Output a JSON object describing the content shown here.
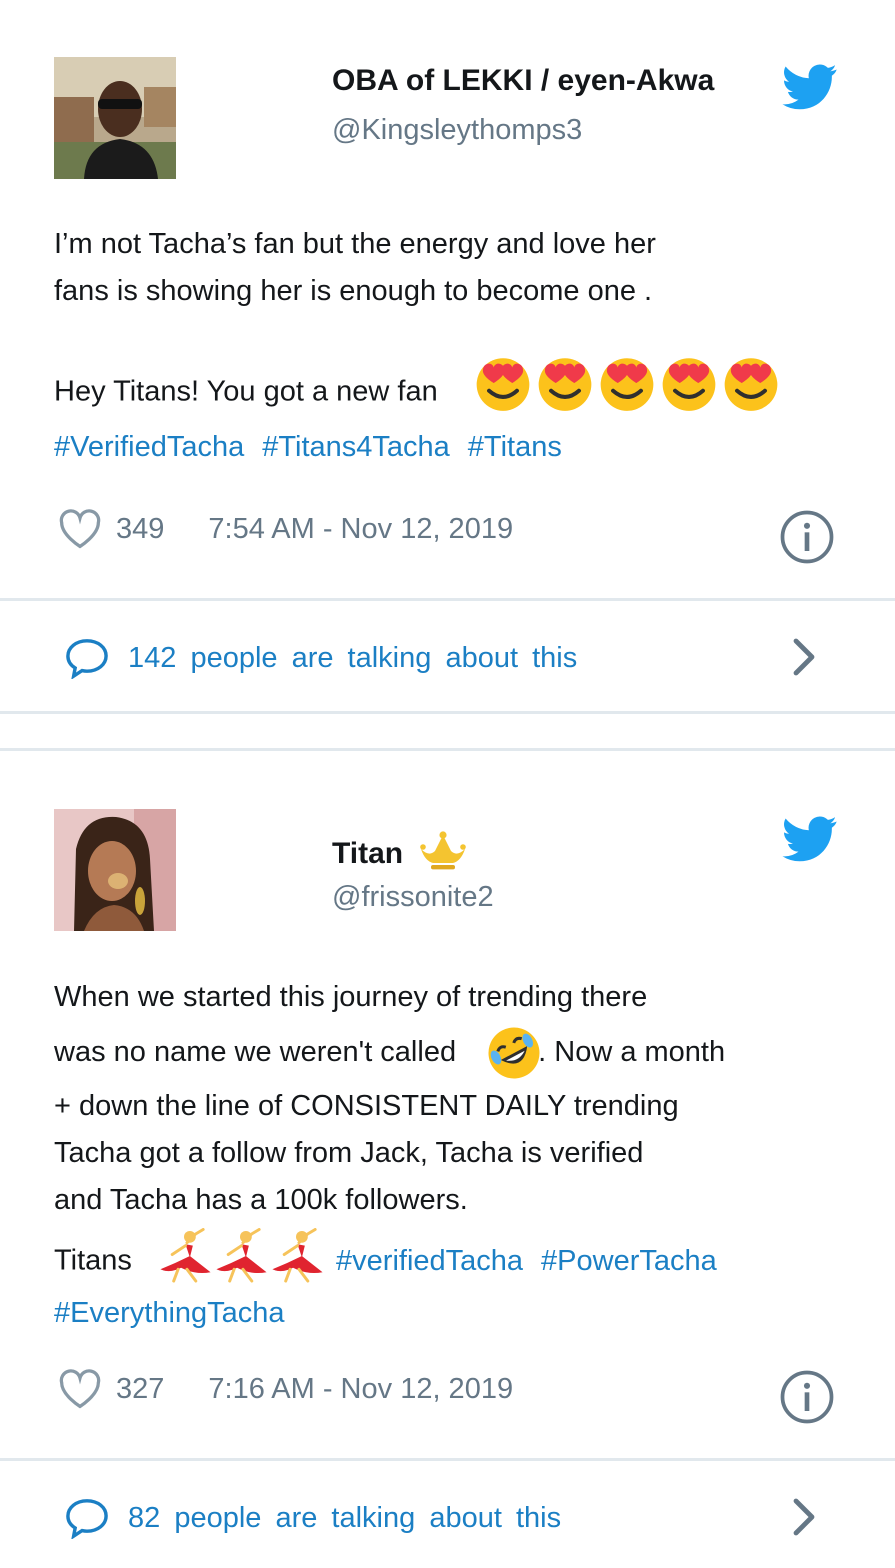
{
  "tweets": [
    {
      "display_name": "OBA  of  LEKKI  /  eyen-Akwa",
      "handle": "@Kingsleythomps3",
      "body_lines": [
        "I’m not Tacha’s fan but the energy and love her",
        "fans is showing her is enough to become one ."
      ],
      "line3": "Hey Titans! You got a new fan",
      "emoji_name": "smiling-face-with-heart-eyes-icon",
      "emoji_count": 5,
      "hashtags": [
        "#VerifiedTacha",
        "#Titans4Tacha",
        "#Titans"
      ],
      "likes": "349",
      "timestamp": "7:54  AM  -  Nov  12,  2019",
      "talking": "142 people are talking about this"
    },
    {
      "display_name": "Titan",
      "handle": "@frissonite2",
      "badge_icon": "crown-icon",
      "body_line1": "When we started this journey of trending there",
      "body_line2a": "was no name we weren't called",
      "body_line2_emoji": "rolling-on-floor-laughing-icon",
      "body_line2b": ". Now a month",
      "body_lines_rest": [
        "+ down the line of CONSISTENT DAILY trending",
        "Tacha got a follow from Jack, Tacha is verified",
        "and Tacha has a 100k followers."
      ],
      "titans_label": "Titans",
      "dancer_emoji": "woman-dancing-icon",
      "dancer_count": 3,
      "hashtags_line1": [
        "#verifiedTacha",
        "#PowerTacha"
      ],
      "hashtags_line2": [
        "#EverythingTacha"
      ],
      "likes": "327",
      "timestamp": "7:16  AM  -  Nov  12,  2019",
      "talking": "82 people are talking about this"
    }
  ],
  "colors": {
    "twitter_blue": "#1da1f2",
    "link_blue": "#1b7fc4",
    "text": "#14171a",
    "muted": "#657786",
    "divider": "#e1e8ed"
  },
  "icons": [
    "twitter-bird-icon",
    "heart-icon",
    "info-icon",
    "speech-bubble-icon",
    "chevron-right-icon"
  ]
}
